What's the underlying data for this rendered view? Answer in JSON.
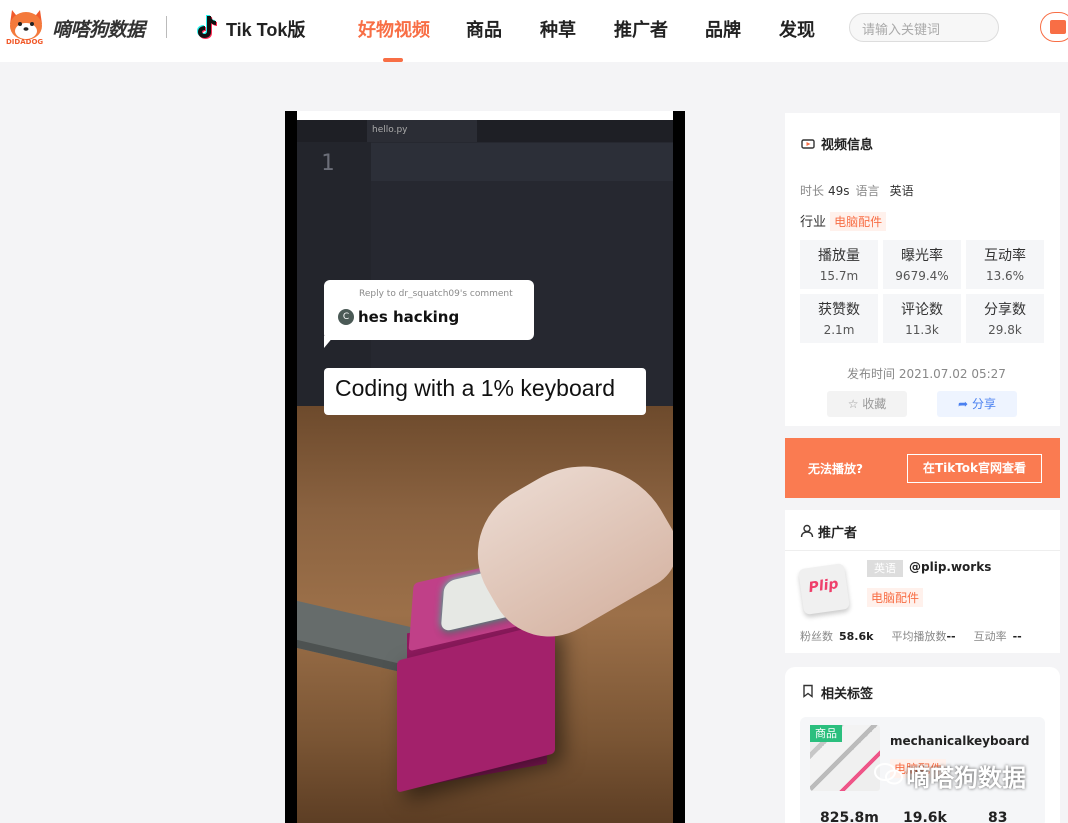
{
  "header": {
    "logo_text": "嘀嗒狗数据",
    "logo_sub": "DIDADOG",
    "platform_label": "Tik Tok版",
    "nav": [
      {
        "label": "好物视频",
        "active": true
      },
      {
        "label": "商品",
        "active": false
      },
      {
        "label": "种草",
        "active": false
      },
      {
        "label": "推广者",
        "active": false
      },
      {
        "label": "品牌",
        "active": false
      },
      {
        "label": "发现",
        "active": false
      }
    ],
    "search_placeholder": "请输入关键词",
    "accent_color": "#f86e45"
  },
  "video": {
    "editor_filename": "hello.py",
    "line_number": "1",
    "reply_to": "Reply to dr_squatch09's comment",
    "avatar_letter": "C",
    "comment": "hes hacking",
    "caption": "Coding with a 1% keyboard"
  },
  "video_info": {
    "title": "视频信息",
    "duration_label": "时长",
    "duration_value": "49s",
    "language_label": "语言",
    "language_value": "英语",
    "industry_label": "行业",
    "industry_value": "电脑配件",
    "stats": [
      {
        "label": "播放量",
        "value": "15.7m"
      },
      {
        "label": "曝光率",
        "value": "9679.4%"
      },
      {
        "label": "互动率",
        "value": "13.6%"
      },
      {
        "label": "获赞数",
        "value": "2.1m"
      },
      {
        "label": "评论数",
        "value": "11.3k"
      },
      {
        "label": "分享数",
        "value": "29.8k"
      }
    ],
    "publish_time": "发布时间 2021.07.02 05:27",
    "favorite_label": "收藏",
    "share_label": "分享"
  },
  "cta": {
    "text": "无法播放?",
    "button": "在TikTok官网查看"
  },
  "promoter": {
    "title": "推广者",
    "logo_text": "Plip",
    "language_badge": "英语",
    "handle": "@plip.works",
    "industry": "电脑配件",
    "fans_label": "粉丝数",
    "fans_value": "58.6k",
    "avg_play_label": "平均播放数",
    "avg_play_value": "--",
    "engagement_label": "互动率",
    "engagement_value": "--"
  },
  "related_tags": {
    "title": "相关标签",
    "items": [
      {
        "badge": "商品",
        "name": "mechanicalkeyboard",
        "industry": "电脑配件",
        "stats": [
          "825.8m",
          "19.6k",
          "83"
        ]
      }
    ]
  },
  "watermark": "嘀嗒狗数据"
}
